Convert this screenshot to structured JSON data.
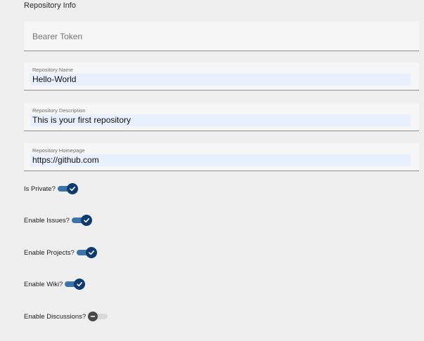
{
  "section": {
    "title": "Repository Info"
  },
  "fields": {
    "bearer_token": {
      "placeholder": "Bearer Token",
      "value": ""
    },
    "repo_name": {
      "label": "Repository Name",
      "value": "Hello-World"
    },
    "repo_description": {
      "label": "Repository Description",
      "value": "This is your first repository"
    },
    "repo_homepage": {
      "label": "Repository Homepage",
      "value": "https://github.com"
    }
  },
  "toggles": {
    "is_private": {
      "label": "Is Private?",
      "checked": true
    },
    "enable_issues": {
      "label": "Enable Issues?",
      "checked": true
    },
    "enable_projects": {
      "label": "Enable Projects?",
      "checked": true
    },
    "enable_wiki": {
      "label": "Enable Wiki?",
      "checked": true
    },
    "enable_discussions": {
      "label": "Enable Discussions?",
      "checked": false
    }
  },
  "colors": {
    "track_on": "#3b74a8",
    "thumb_on": "#0d3b70",
    "track_off": "#d8d8d8",
    "thumb_off": "#4a4a4a",
    "autofill": "#e8f0fe"
  },
  "icons": {
    "on": "check-icon",
    "off": "minus-icon"
  }
}
